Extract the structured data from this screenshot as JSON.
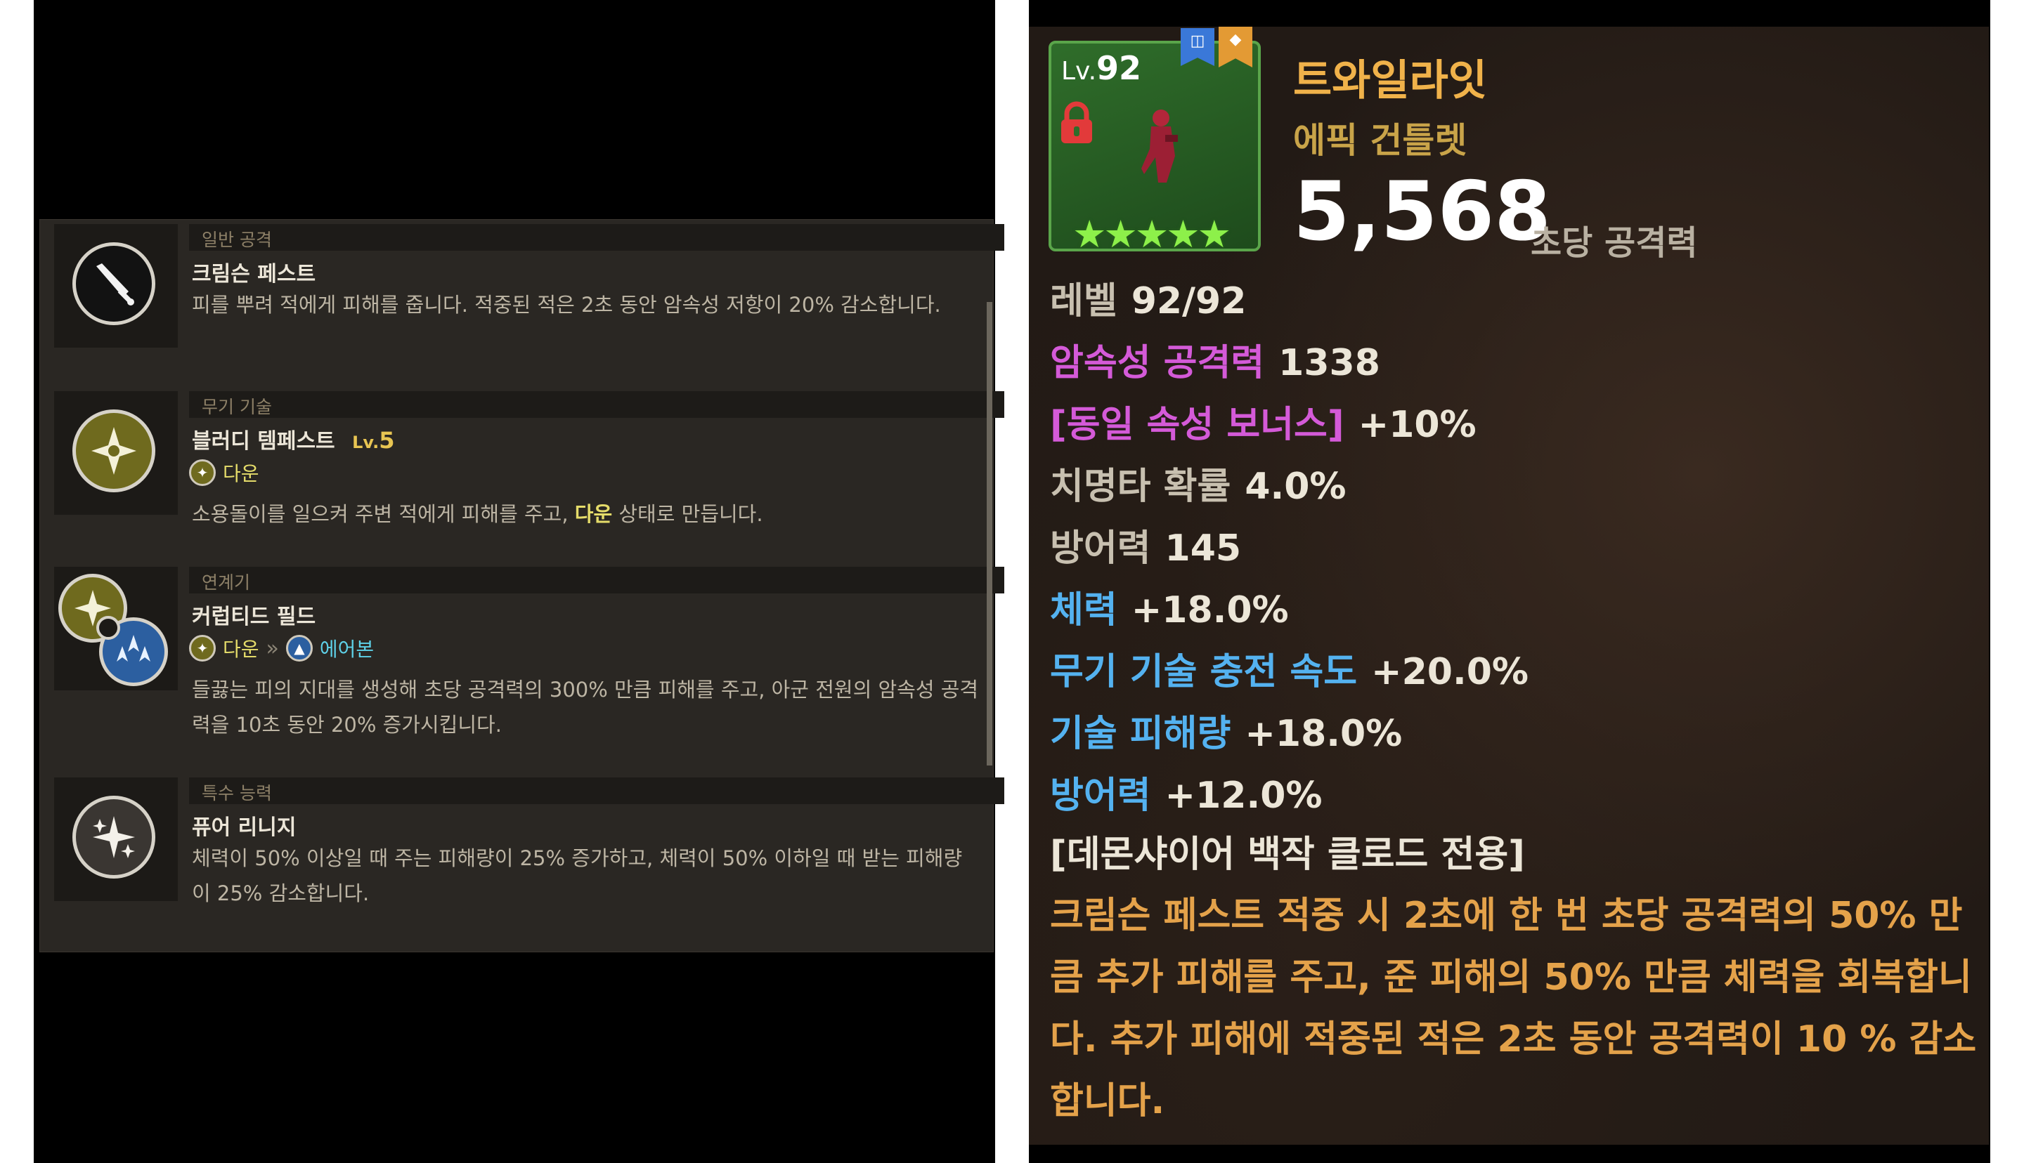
{
  "skills": [
    {
      "category": "일반 공격",
      "name": "크림슨 페스트",
      "icon": "sword-icon",
      "description": "피를 뿌려 적에게 피해를 줍니다. 적중된 적은 2초 동안 암속성 저항이 20% 감소합니다."
    },
    {
      "category": "무기 기술",
      "name": "블러디 템페스트",
      "level_prefix": "Lv.",
      "level_value": "5",
      "icon": "burst-icon",
      "tag": "다운",
      "description_before": "소용돌이를 일으켜 주변 적에게 피해를 주고, ",
      "description_highlight": "다운",
      "description_after": " 상태로 만듭니다."
    },
    {
      "category": "연계기",
      "name": "커럽티드 필드",
      "icon": "chain-icon",
      "tag_from": "다운",
      "tag_arrow": "»",
      "tag_to": "에어본",
      "description": "들끓는 피의 지대를 생성해 초당 공격력의 300% 만큼 피해를 주고, 아군 전원의 암속성 공격력을 10초 동안 20% 증가시킵니다."
    },
    {
      "category": "특수 능력",
      "name": "퓨어 리니지",
      "icon": "sparkle-icon",
      "description": "체력이 50% 이상일 때 주는 피해량이 25% 증가하고, 체력이 50% 이하일 때 받는 피해량이 25% 감소합니다."
    }
  ],
  "item": {
    "level_prefix": "Lv.",
    "level_value": "92",
    "stars": "★★★★★",
    "star_count": 5,
    "name": "트와일라잇",
    "type": "에픽 건틀렛",
    "power": "5,568",
    "power_label": "초당 공격력",
    "stats": [
      {
        "label": "레벨",
        "value": "92/92",
        "label_color": "grey"
      },
      {
        "label": "암속성 공격력",
        "value": "1338",
        "label_color": "pink"
      },
      {
        "label": "[동일 속성 보너스]",
        "value": "+10%",
        "label_color": "pink"
      },
      {
        "label": "치명타 확률",
        "value": "4.0%",
        "label_color": "grey"
      },
      {
        "label": "방어력",
        "value": "145",
        "label_color": "grey"
      },
      {
        "label": "체력",
        "value": "+18.0%",
        "label_color": "blue"
      },
      {
        "label": "무기 기술 충전 속도",
        "value": "+20.0%",
        "label_color": "blue"
      },
      {
        "label": "기술 피해량",
        "value": "+18.0%",
        "label_color": "blue"
      },
      {
        "label": "방어력",
        "value": "+12.0%",
        "label_color": "blue"
      }
    ],
    "special_title": "[데몬샤이어 백작 클로드 전용]",
    "special_description": "크림슨 페스트 적중 시 2초에 한 번 초당 공격력의 50% 만큼 추가 피해를 주고, 준 피해의 50% 만큼 체력을 회복합니다. 추가 피해에 적중된 적은 2초 동안 공격력이 10 % 감소합니다."
  },
  "colors": {
    "panel_bg": "#2a2723",
    "item_gold": "#f0b24a",
    "stat_pink": "#d45ad8",
    "stat_blue": "#54b2f0",
    "special_orange": "#e4a24a",
    "star_green": "#8df04a"
  }
}
